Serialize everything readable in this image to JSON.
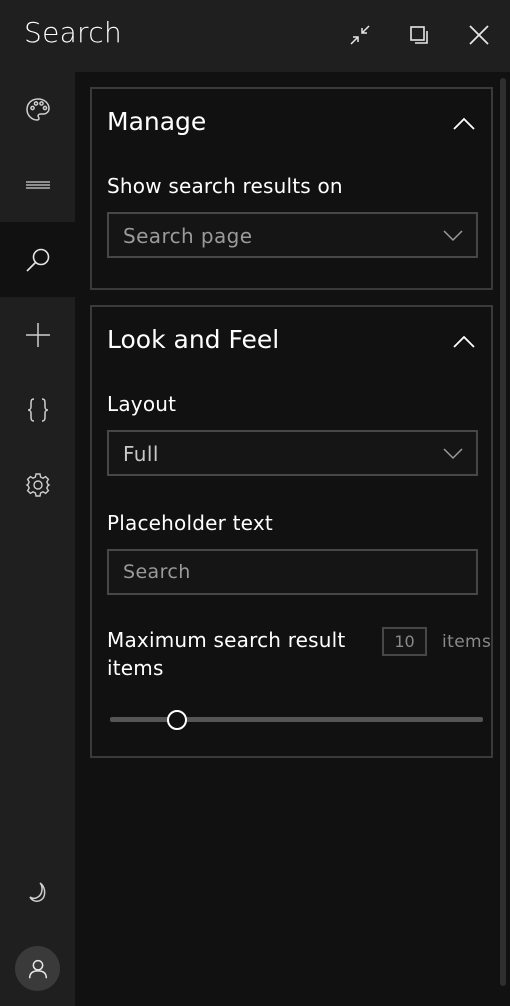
{
  "window": {
    "title": "Search",
    "controls": [
      "collapse-icon",
      "popout-icon",
      "close-icon"
    ]
  },
  "sidebar": {
    "items": [
      {
        "icon": "palette-icon",
        "active": false
      },
      {
        "icon": "menu-lines-icon",
        "active": false
      },
      {
        "icon": "search-icon",
        "active": true
      },
      {
        "icon": "plus-icon",
        "active": false
      },
      {
        "icon": "braces-icon",
        "active": false
      },
      {
        "icon": "gear-icon",
        "active": false
      }
    ],
    "bottom": [
      "moon-icon",
      "user-icon"
    ]
  },
  "manage": {
    "title": "Manage",
    "show_results_label": "Show search results on",
    "show_results_value": "Search page"
  },
  "look_and_feel": {
    "title": "Look and Feel",
    "layout_label": "Layout",
    "layout_value": "Full",
    "placeholder_label": "Placeholder text",
    "placeholder_value": "Search",
    "max_items_label_line1": "Maximum search result",
    "max_items_label_line2": "items",
    "max_items_value": "10",
    "max_items_units": "items",
    "max_items_slider_fraction": 0.18
  },
  "colors": {
    "background": "#111111",
    "sidebar": "#1f1f1f",
    "border": "#3a3a3a",
    "text": "#ffffff",
    "muted": "#9a9a9a"
  }
}
